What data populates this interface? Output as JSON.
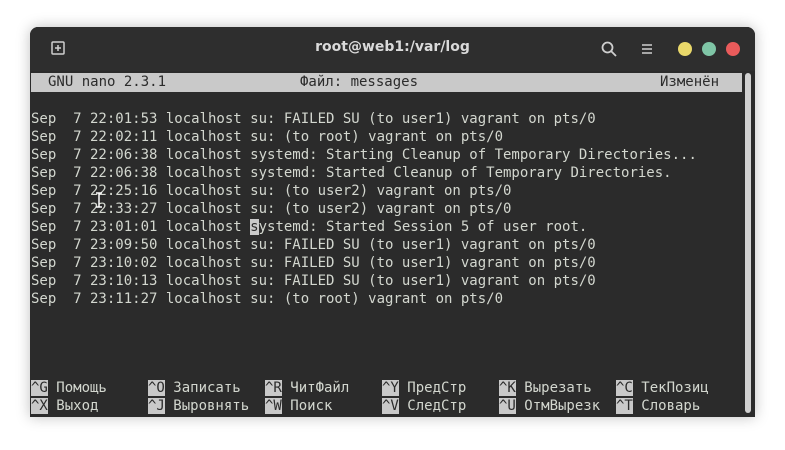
{
  "window": {
    "title": "root@web1:/var/log"
  },
  "header": {
    "app": "GNU nano 2.3.1",
    "file": "Файл: messages",
    "status": "Изменён"
  },
  "log_lines": [
    "Sep  7 22:01:53 localhost su: FAILED SU (to user1) vagrant on pts/0",
    "Sep  7 22:02:11 localhost su: (to root) vagrant on pts/0",
    "Sep  7 22:06:38 localhost systemd: Starting Cleanup of Temporary Directories...",
    "Sep  7 22:06:38 localhost systemd: Started Cleanup of Temporary Directories.",
    "Sep  7 22:25:16 localhost su: (to user2) vagrant on pts/0",
    "Sep  7 22:33:27 localhost su: (to user2) vagrant on pts/0",
    "Sep  7 23:01:01 localhost systemd: Started Session 5 of user root.",
    "Sep  7 23:09:50 localhost su: FAILED SU (to user1) vagrant on pts/0",
    "Sep  7 23:10:02 localhost su: FAILED SU (to user1) vagrant on pts/0",
    "Sep  7 23:10:13 localhost su: FAILED SU (to user1) vagrant on pts/0",
    "Sep  7 23:11:27 localhost su: (to root) vagrant on pts/0"
  ],
  "cursor_line": {
    "before": "Sep  7 23:01:01 localhost ",
    "char": "s",
    "after": "ystemd: Started Session 5 of user root."
  },
  "shortcuts": {
    "row1": [
      {
        "key": "^G",
        "label": " Помощь"
      },
      {
        "key": "^O",
        "label": " Записать"
      },
      {
        "key": "^R",
        "label": " ЧитФайл"
      },
      {
        "key": "^Y",
        "label": " ПредСтр"
      },
      {
        "key": "^K",
        "label": " Вырезать"
      },
      {
        "key": "^C",
        "label": " ТекПозиц"
      }
    ],
    "row2": [
      {
        "key": "^X",
        "label": " Выход"
      },
      {
        "key": "^J",
        "label": " Выровнять"
      },
      {
        "key": "^W",
        "label": " Поиск"
      },
      {
        "key": "^V",
        "label": " СледСтр"
      },
      {
        "key": "^U",
        "label": " ОтмВырезк"
      },
      {
        "key": "^T",
        "label": " Словарь"
      }
    ]
  },
  "colors": {
    "background": "#2b2b2b",
    "text": "#d3d7cf",
    "highlight": "#c9c9c9",
    "close": "#e95b5b",
    "maximize": "#7fc5a6",
    "minimize": "#e9d86a"
  }
}
